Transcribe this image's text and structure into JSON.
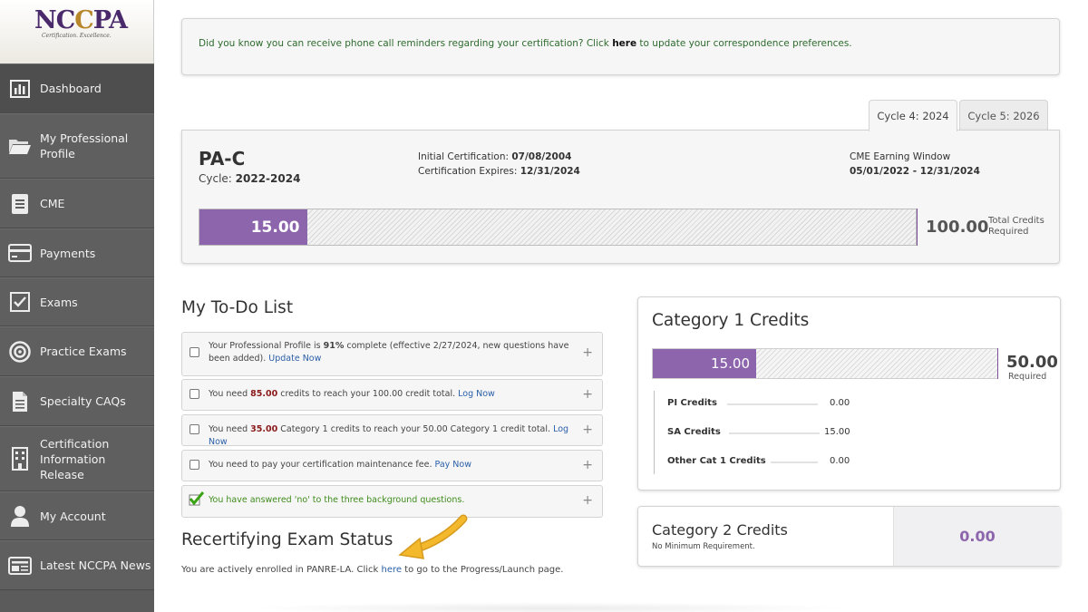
{
  "logo": {
    "brand": "NCCPA",
    "tagline": "Certification.   Excellence."
  },
  "sidebar": {
    "items": [
      {
        "label": "Dashboard",
        "icon": "bar-chart-icon"
      },
      {
        "label": "My Professional Profile",
        "icon": "folder-icon"
      },
      {
        "label": "CME",
        "icon": "document-icon"
      },
      {
        "label": "Payments",
        "icon": "credit-card-icon"
      },
      {
        "label": "Exams",
        "icon": "checkbox-icon"
      },
      {
        "label": "Practice Exams",
        "icon": "target-icon"
      },
      {
        "label": "Specialty CAQs",
        "icon": "file-icon"
      },
      {
        "label": "Certification Information Release",
        "icon": "building-icon"
      },
      {
        "label": "My Account",
        "icon": "user-icon"
      },
      {
        "label": "Latest NCCPA News",
        "icon": "newspaper-icon"
      }
    ]
  },
  "notice": {
    "text_before": "Did you know you can receive phone call reminders regarding your certification? Click ",
    "link": "here",
    "text_after": " to update your correspondence preferences."
  },
  "cycle_tabs": [
    "Cycle 4: 2024",
    "Cycle 5: 2026"
  ],
  "certification": {
    "title": "PA-C",
    "cycle_label": "Cycle: ",
    "cycle_value": "2022-2024",
    "initial_label": "Initial Certification: ",
    "initial_value": "07/08/2004",
    "expires_label": "Certification Expires: ",
    "expires_value": "12/31/2024",
    "window_label": "CME Earning Window",
    "window_value": "05/01/2022 - 12/31/2024",
    "earned": "15.00",
    "required": "100.00",
    "required_label": "Total Credits Required",
    "progress_fraction": 0.15
  },
  "todo": {
    "title": "My To-Do List",
    "items": [
      {
        "pre": "Your Professional Profile is ",
        "em": "91%",
        "post": " complete (effective 2/27/2024, new questions have been added). ",
        "link": "Update Now"
      },
      {
        "pre": "You need ",
        "em": "85.00",
        "post": " credits to reach your 100.00 credit total. ",
        "link": "Log Now"
      },
      {
        "pre": "You need ",
        "em": "35.00",
        "post": " Category 1 credits to reach your 50.00 Category 1 credit total. ",
        "link": "Log Now"
      },
      {
        "pre": "You need to pay your certification maintenance fee. ",
        "em": "",
        "post": "",
        "link": "Pay Now"
      },
      {
        "pre": "You have answered 'no' to the three background questions.",
        "em": "",
        "post": "",
        "link": ""
      }
    ]
  },
  "exam": {
    "title": "Recertifying Exam Status",
    "pre": "You are actively enrolled in PANRE-LA. Click ",
    "link": "here",
    "post": " to go to the Progress/Launch page."
  },
  "category1": {
    "title": "Category 1 Credits",
    "earned": "15.00",
    "required": "50.00",
    "required_label": "Required",
    "progress_fraction": 0.3,
    "rows": [
      {
        "label": "PI Credits",
        "value": "0.00"
      },
      {
        "label": "SA Credits",
        "value": "15.00"
      },
      {
        "label": "Other Cat 1 Credits",
        "value": "0.00"
      }
    ]
  },
  "category2": {
    "title": "Category 2 Credits",
    "subtitle": "No Minimum Requirement.",
    "value": "0.00"
  },
  "colors": {
    "accent": "#8d65ad",
    "sidebar": "#5b5b5b",
    "link": "#2a5fa8",
    "notice_text": "#2e6b2e",
    "arrow": "#f0b429"
  }
}
